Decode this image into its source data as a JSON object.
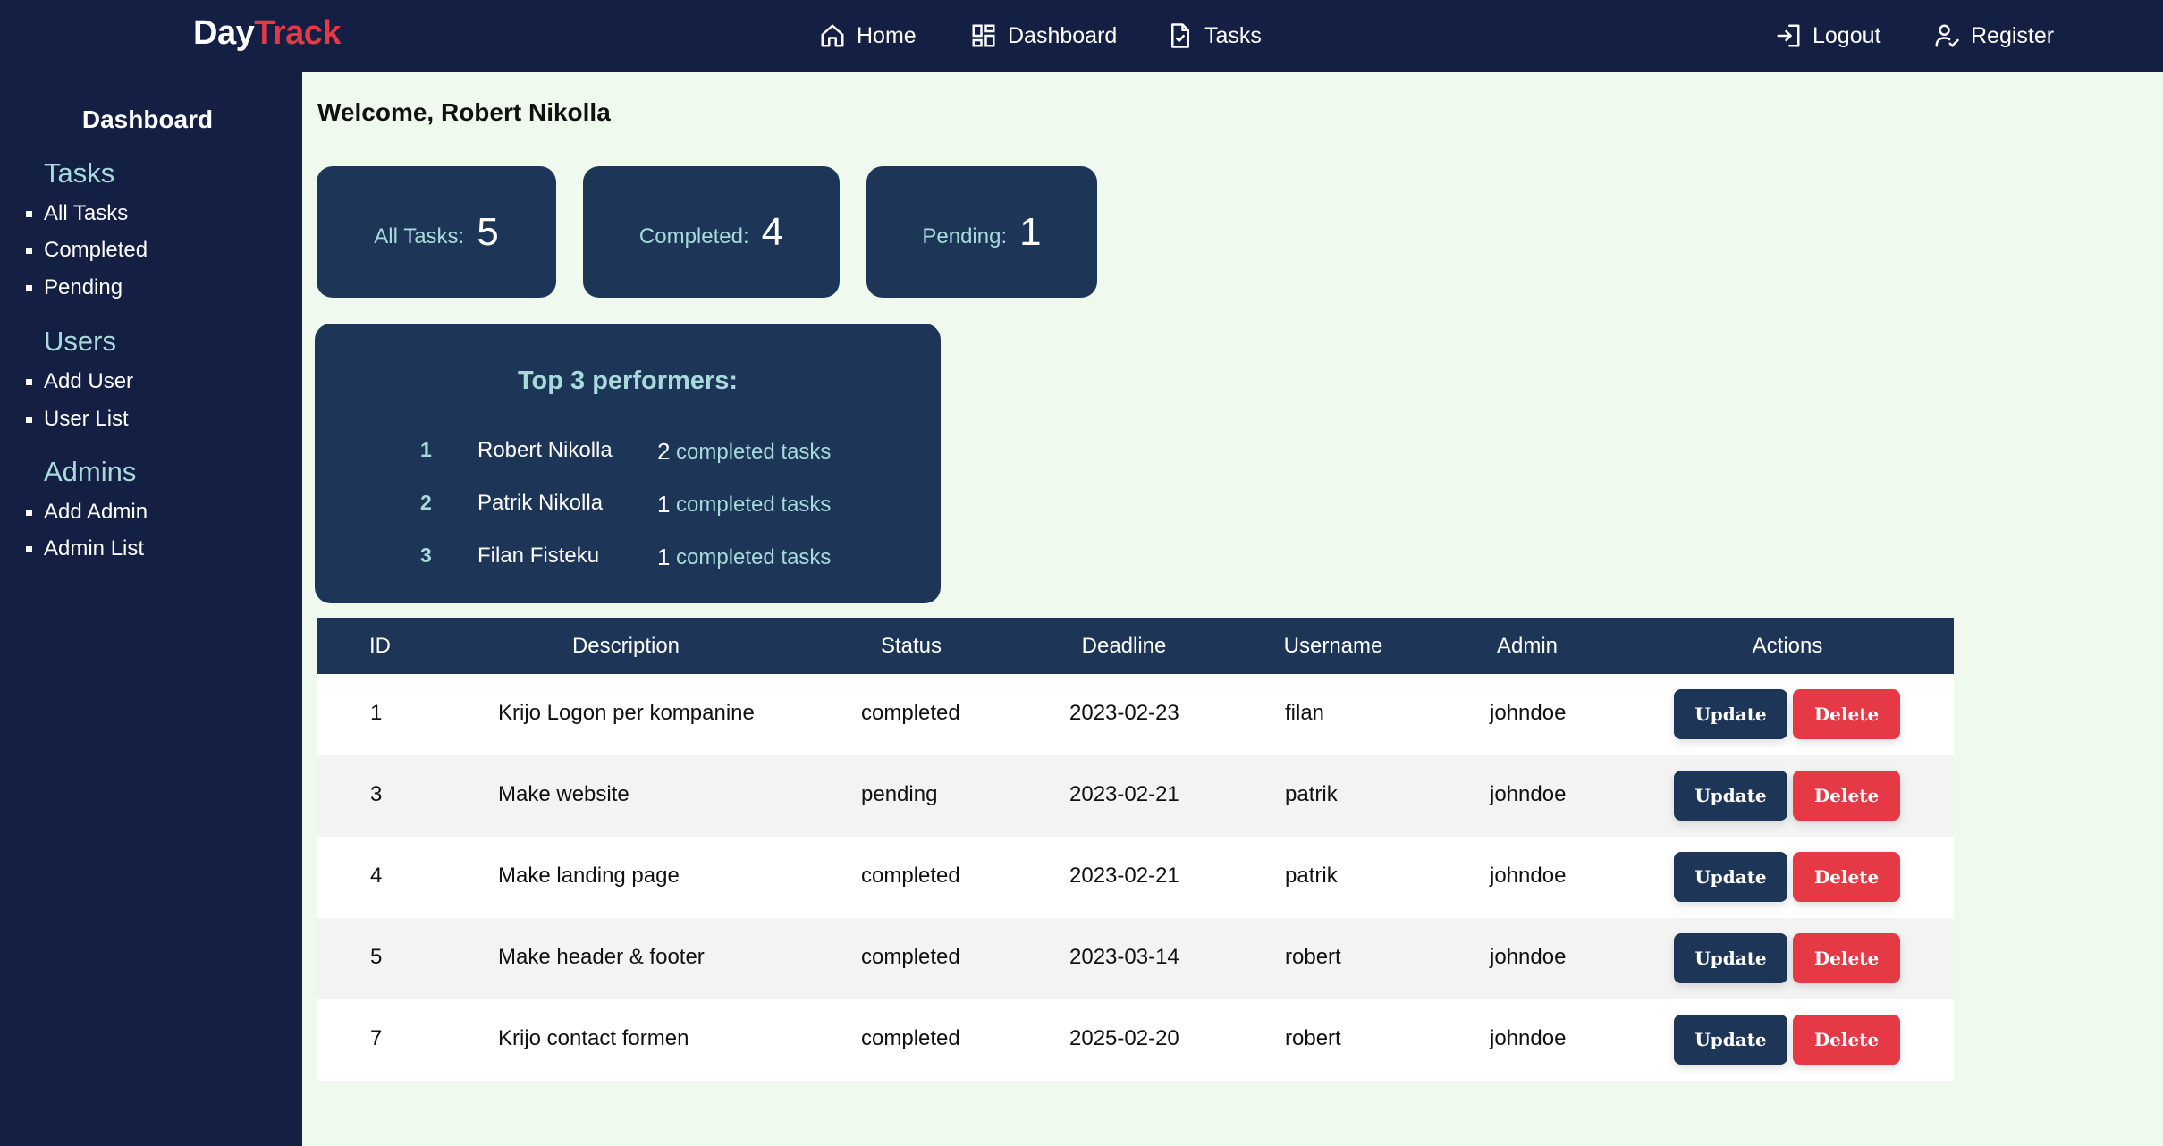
{
  "app": {
    "logo_main": "Day",
    "logo_accent": "Track"
  },
  "nav": {
    "home": "Home",
    "dashboard": "Dashboard",
    "tasks": "Tasks",
    "logout": "Logout",
    "register": "Register"
  },
  "sidebar": {
    "title": "Dashboard",
    "sections": [
      {
        "heading": "Tasks",
        "items": [
          "All Tasks",
          "Completed",
          "Pending"
        ]
      },
      {
        "heading": "Users",
        "items": [
          "Add User",
          "User List"
        ]
      },
      {
        "heading": "Admins",
        "items": [
          "Add Admin",
          "Admin List"
        ]
      }
    ]
  },
  "welcome": "Welcome, Robert Nikolla",
  "stats": {
    "all_label": "All Tasks:",
    "all_value": "5",
    "completed_label": "Completed:",
    "completed_value": "4",
    "pending_label": "Pending:",
    "pending_value": "1"
  },
  "performers": {
    "title": "Top 3 performers:",
    "suffix": "completed tasks",
    "rows": [
      {
        "rank": "1",
        "name": "Robert Nikolla",
        "count": "2"
      },
      {
        "rank": "2",
        "name": "Patrik Nikolla",
        "count": "1"
      },
      {
        "rank": "3",
        "name": "Filan Fisteku",
        "count": "1"
      }
    ]
  },
  "table": {
    "headers": [
      "ID",
      "Description",
      "Status",
      "Deadline",
      "Username",
      "Admin",
      "Actions"
    ],
    "update_label": "Update",
    "delete_label": "Delete",
    "rows": [
      {
        "id": "1",
        "description": "Krijo Logon per kompanine",
        "status": "completed",
        "deadline": "2023-02-23",
        "username": "filan",
        "admin": "johndoe"
      },
      {
        "id": "3",
        "description": "Make website",
        "status": "pending",
        "deadline": "2023-02-21",
        "username": "patrik",
        "admin": "johndoe"
      },
      {
        "id": "4",
        "description": "Make landing page",
        "status": "completed",
        "deadline": "2023-02-21",
        "username": "patrik",
        "admin": "johndoe"
      },
      {
        "id": "5",
        "description": "Make header & footer",
        "status": "completed",
        "deadline": "2023-03-14",
        "username": "robert",
        "admin": "johndoe"
      },
      {
        "id": "7",
        "description": "Krijo contact formen",
        "status": "completed",
        "deadline": "2025-02-20",
        "username": "robert",
        "admin": "johndoe"
      }
    ]
  },
  "colors": {
    "brand_dark": "#141f44",
    "panel": "#1d3557",
    "accent_red": "#e63946",
    "accent_light": "#a8dadc",
    "page_bg": "#f0f9ee"
  }
}
